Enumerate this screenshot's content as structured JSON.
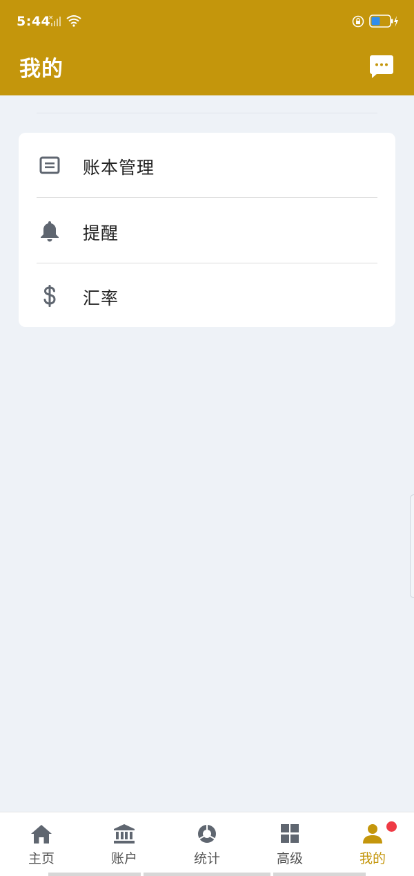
{
  "status_bar": {
    "time": "5:44",
    "icons": [
      "signal-off-icon",
      "wifi-icon",
      "rotation-lock-icon",
      "battery-charging-icon"
    ]
  },
  "header": {
    "title": "我的",
    "action_icon": "message-icon"
  },
  "menu": {
    "items": [
      {
        "label": "账本管理",
        "icon": "ledger-icon"
      },
      {
        "label": "提醒",
        "icon": "bell-icon"
      },
      {
        "label": "汇率",
        "icon": "dollar-icon"
      }
    ]
  },
  "tabbar": {
    "items": [
      {
        "label": "主页",
        "icon": "home-icon"
      },
      {
        "label": "账户",
        "icon": "bank-icon"
      },
      {
        "label": "统计",
        "icon": "pie-chart-icon"
      },
      {
        "label": "高级",
        "icon": "grid-icon"
      },
      {
        "label": "我的",
        "icon": "person-icon",
        "active": true,
        "badge": true
      }
    ]
  },
  "colors": {
    "brand": "#c4960c",
    "background": "#eef2f7",
    "icon_gray": "#5f6670",
    "badge": "#ef3a45"
  }
}
